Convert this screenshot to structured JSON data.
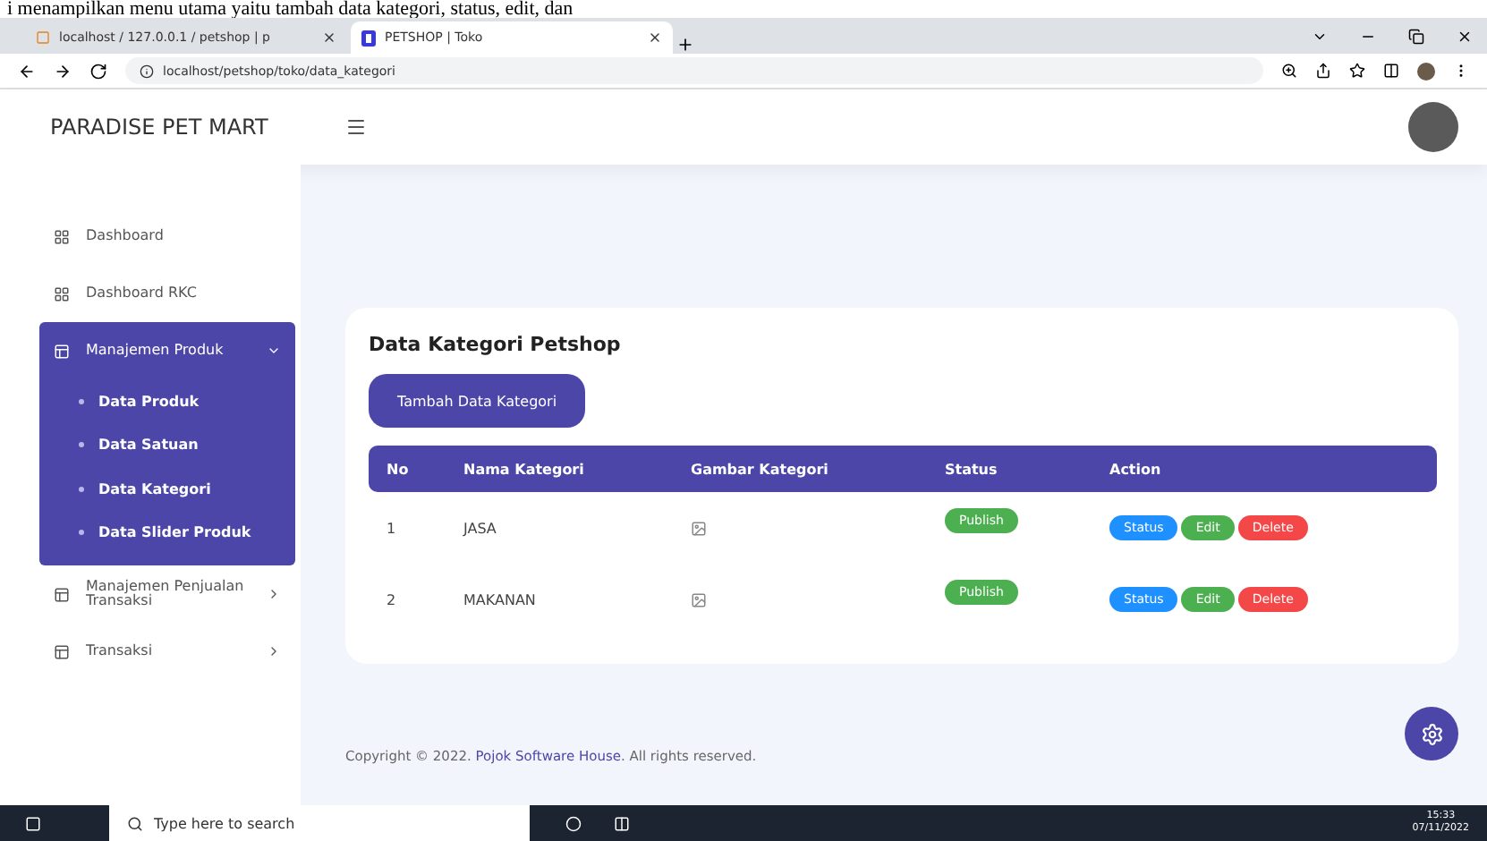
{
  "caption": "i menampilkan menu utama yaitu tambah data kategori, status, edit, dan",
  "browser": {
    "tabs": [
      {
        "title": "localhost / 127.0.0.1 / petshop | p",
        "selected": false
      },
      {
        "title": "PETSHOP | Toko",
        "selected": true
      }
    ],
    "url": "localhost/petshop/toko/data_kategori"
  },
  "app": {
    "brand": "PARADISE PET MART",
    "sidebar": [
      {
        "label": "Dashboard",
        "kind": "dashboard",
        "selected": false
      },
      {
        "label": "Dashboard RKC",
        "kind": "dashboard",
        "selected": false
      },
      {
        "label": "Manajemen Produk",
        "kind": "group",
        "selected": true,
        "expanded": true,
        "children": [
          {
            "label": "Data Produk"
          },
          {
            "label": "Data Satuan"
          },
          {
            "label": "Data Kategori"
          },
          {
            "label": "Data Slider Produk"
          }
        ]
      },
      {
        "label": "Manajemen Penjualan Transaksi",
        "kind": "group",
        "selected": false,
        "expanded": false
      },
      {
        "label": "Transaksi",
        "kind": "group",
        "selected": false,
        "expanded": false
      }
    ],
    "title": "Data Kategori Petshop",
    "add_button": "Tambah Data Kategori",
    "columns": [
      "No",
      "Nama Kategori",
      "Gambar Kategori",
      "Status",
      "Action"
    ],
    "rows": [
      {
        "no": "1",
        "name": "JASA",
        "status": "Publish",
        "actions": [
          {
            "label": "Status",
            "color": "#1e90ff"
          },
          {
            "label": "Edit",
            "color": "#4caf50"
          },
          {
            "label": "Delete",
            "color": "#f44747"
          }
        ]
      },
      {
        "no": "2",
        "name": "MAKANAN",
        "status": "Publish",
        "actions": [
          {
            "label": "Status",
            "color": "#1e90ff"
          },
          {
            "label": "Edit",
            "color": "#4caf50"
          },
          {
            "label": "Delete",
            "color": "#f44747"
          }
        ]
      }
    ],
    "footer": {
      "prefix": "Copyright © 2022.",
      "link": "Pojok Software House",
      "suffix": ". All rights reserved."
    }
  },
  "taskbar": {
    "search_placeholder": "Type here to search",
    "time": "15:33",
    "date": "07/11/2022"
  }
}
